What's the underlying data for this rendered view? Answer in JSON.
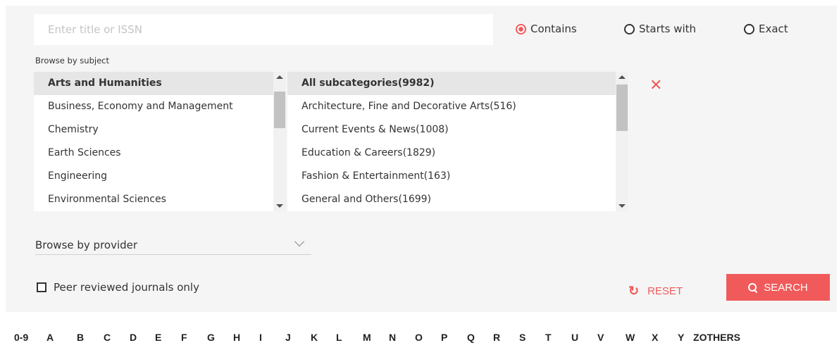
{
  "search": {
    "placeholder": "Enter title or ISSN"
  },
  "match_modes": [
    {
      "label": "Contains",
      "selected": true
    },
    {
      "label": "Starts with",
      "selected": false
    },
    {
      "label": "Exact",
      "selected": false
    }
  ],
  "subject": {
    "label": "Browse by subject",
    "categories": [
      {
        "label": "Arts and Humanities",
        "selected": true
      },
      {
        "label": "Business, Economy and Management",
        "selected": false
      },
      {
        "label": "Chemistry",
        "selected": false
      },
      {
        "label": "Earth Sciences",
        "selected": false
      },
      {
        "label": "Engineering",
        "selected": false
      },
      {
        "label": "Environmental Sciences",
        "selected": false
      }
    ],
    "subcategories": [
      {
        "label": "All subcategories(9982)",
        "selected": true
      },
      {
        "label": "Architecture, Fine and Decorative Arts(516)",
        "selected": false
      },
      {
        "label": "Current Events & News(1008)",
        "selected": false
      },
      {
        "label": "Education & Careers(1829)",
        "selected": false
      },
      {
        "label": "Fashion & Entertainment(163)",
        "selected": false
      },
      {
        "label": "General and Others(1699)",
        "selected": false
      }
    ],
    "clear_icon": "close-icon"
  },
  "provider": {
    "label": "Browse by provider",
    "icon": "chevron-down-icon"
  },
  "peer_reviewed": {
    "label": "Peer reviewed journals only",
    "checked": false
  },
  "actions": {
    "reset_label": "RESET",
    "search_label": "SEARCH"
  },
  "alphabet": [
    "0-9",
    "A",
    "B",
    "C",
    "D",
    "E",
    "F",
    "G",
    "H",
    "I",
    "J",
    "K",
    "L",
    "M",
    "N",
    "O",
    "P",
    "Q",
    "R",
    "S",
    "T",
    "U",
    "V",
    "W",
    "X",
    "Y",
    "Z",
    "OTHERS"
  ],
  "colors": {
    "accent": "#f05a5a",
    "panel": "#f5f5f5"
  }
}
